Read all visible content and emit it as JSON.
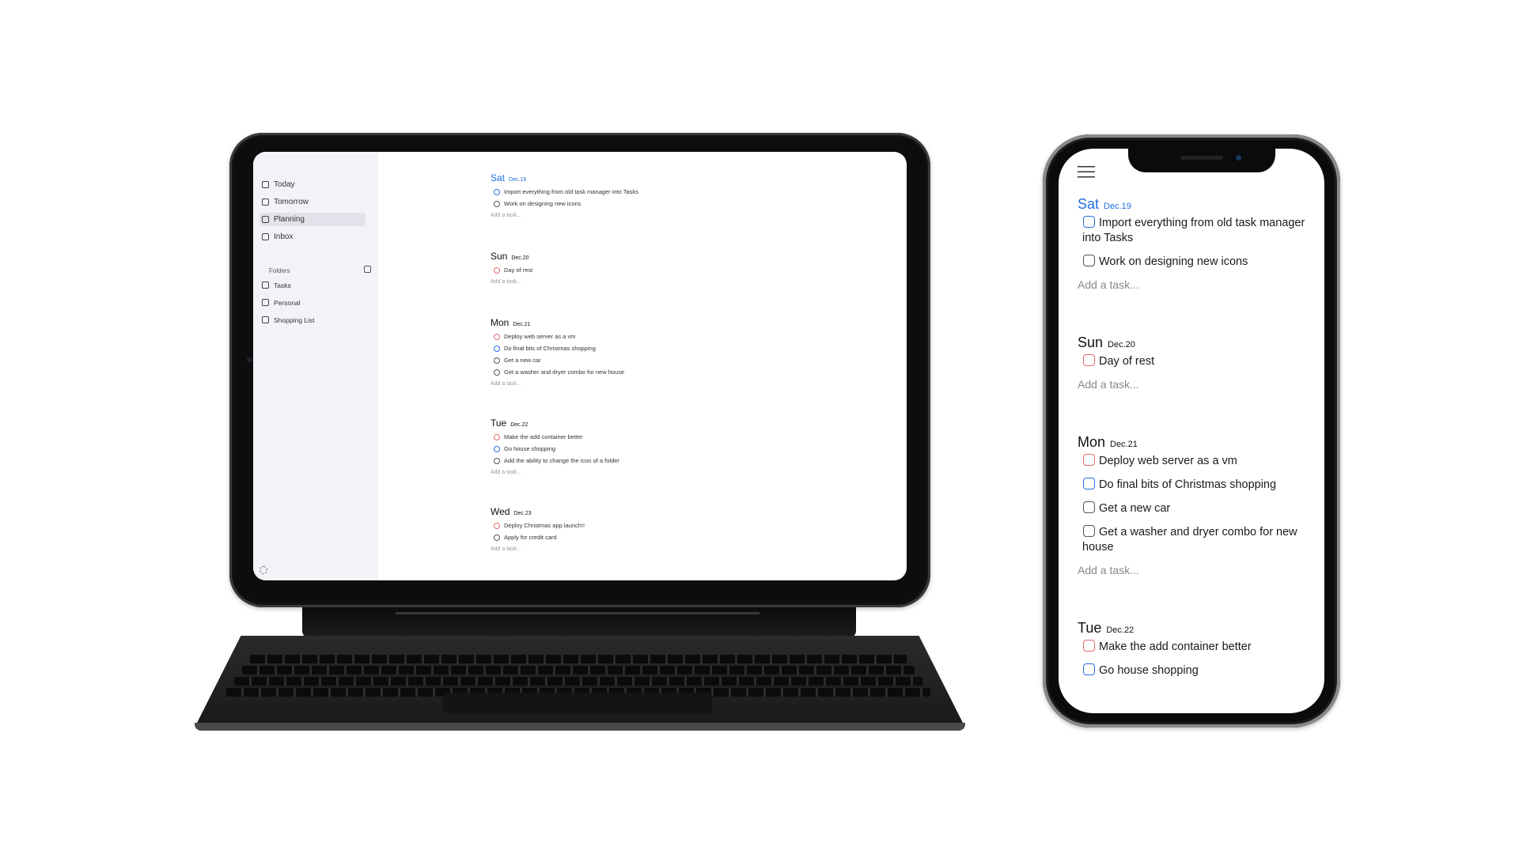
{
  "sidebar": {
    "items": [
      {
        "label": "Today",
        "icon": "calendar-icon"
      },
      {
        "label": "Tomorrow",
        "icon": "calendar-plus-icon"
      },
      {
        "label": "Planning",
        "icon": "planner-icon",
        "active": true
      },
      {
        "label": "Inbox",
        "icon": "inbox-icon"
      }
    ],
    "folders_label": "Folders",
    "folders": [
      {
        "label": "Tasks",
        "icon": "folder-icon"
      },
      {
        "label": "Personal",
        "icon": "folder-icon"
      },
      {
        "label": "Shopping List",
        "icon": "folder-icon"
      }
    ]
  },
  "add_task_label": "Add a task...",
  "colors": {
    "accent": "#1f6fe0",
    "red": "#e46a6a",
    "blue": "#2a6fe0",
    "gray": "#555555"
  },
  "days": [
    {
      "name": "Sat",
      "date": "Dec.19",
      "tasks": [
        {
          "text": "Import everything from old task manager into Tasks",
          "color": "blue"
        },
        {
          "text": "Work on designing new icons",
          "color": "gray"
        }
      ]
    },
    {
      "name": "Sun",
      "date": "Dec.20",
      "tasks": [
        {
          "text": "Day of rest",
          "color": "red"
        }
      ]
    },
    {
      "name": "Mon",
      "date": "Dec.21",
      "tasks": [
        {
          "text": "Deploy web server as a vm",
          "color": "red"
        },
        {
          "text": "Do final bits of Christmas shopping",
          "color": "blue"
        },
        {
          "text": "Get a new car",
          "color": "gray"
        },
        {
          "text": "Get a washer and dryer combo for new house",
          "color": "gray"
        }
      ]
    },
    {
      "name": "Tue",
      "date": "Dec.22",
      "tasks": [
        {
          "text": "Make the add container better",
          "color": "red"
        },
        {
          "text": "Go house shopping",
          "color": "blue"
        },
        {
          "text": "Add the ability to change the icon of a folder",
          "color": "gray"
        }
      ]
    },
    {
      "name": "Wed",
      "date": "Dec.23",
      "tasks": [
        {
          "text": "Deploy Christmas app launch!!",
          "color": "red"
        },
        {
          "text": "Apply for credit card",
          "color": "gray"
        }
      ]
    }
  ]
}
